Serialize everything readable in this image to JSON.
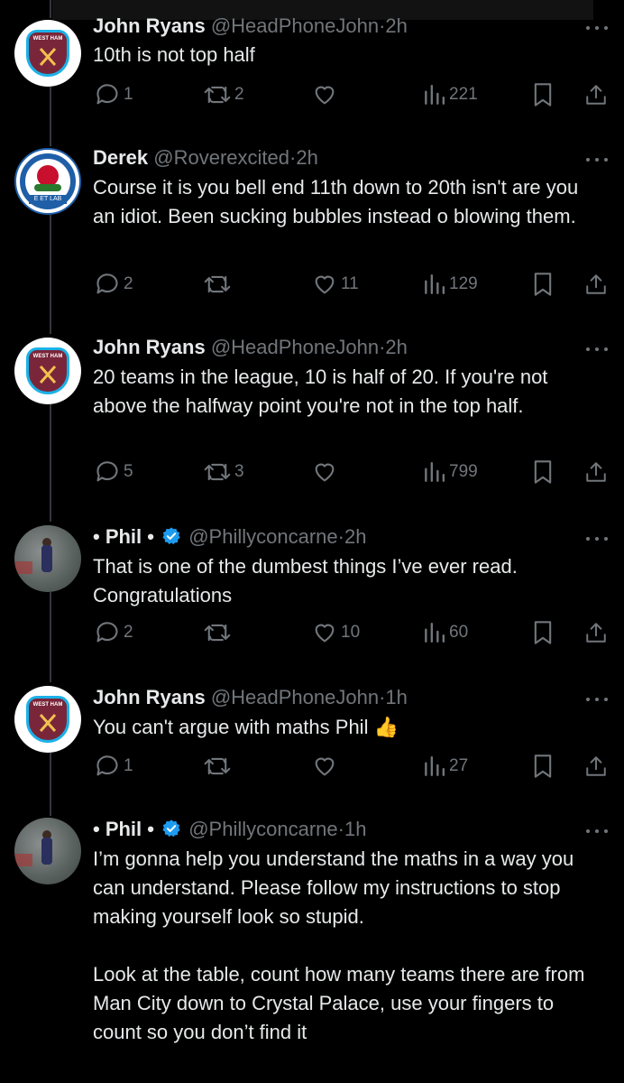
{
  "tweets": [
    {
      "name": "John Ryans",
      "handle": "@HeadPhoneJohn",
      "time": "2h",
      "paragraphs": [
        "10th is not top half"
      ],
      "counts": {
        "reply": "1",
        "retweet": "2",
        "like": "",
        "views": "221"
      },
      "avatar": "west-ham-crest",
      "avatar_text": "WEST HAM"
    },
    {
      "name": "Derek",
      "handle": "@Roverexcited",
      "time": "2h",
      "paragraphs": [
        "Course it is you bell end 11th down to 20th isn't are you an idiot. Been sucking bubbles instead o blowing them."
      ],
      "counts": {
        "reply": "2",
        "retweet": "",
        "like": "11",
        "views": "129"
      },
      "avatar": "blackburn-rovers-crest",
      "avatar_text": "E ET LAB"
    },
    {
      "name": "John Ryans",
      "handle": "@HeadPhoneJohn",
      "time": "2h",
      "paragraphs": [
        "20 teams in the league, 10 is half of 20. If you're not above the halfway point you're not in the top half."
      ],
      "counts": {
        "reply": "5",
        "retweet": "3",
        "like": "",
        "views": "799"
      },
      "avatar": "west-ham-crest",
      "avatar_text": "WEST HAM"
    },
    {
      "name": "• Phil •",
      "handle": "@Phillyconcarne",
      "time": "2h",
      "verified": true,
      "paragraphs": [
        "That is one of the dumbest things I’ve ever read. Congratulations"
      ],
      "counts": {
        "reply": "2",
        "retweet": "",
        "like": "10",
        "views": "60"
      },
      "avatar": "footballer-photo"
    },
    {
      "name": "John Ryans",
      "handle": "@HeadPhoneJohn",
      "time": "1h",
      "paragraphs": [
        "You can't argue with maths Phil"
      ],
      "emoji": "👍",
      "counts": {
        "reply": "1",
        "retweet": "",
        "like": "",
        "views": "27"
      },
      "avatar": "west-ham-crest",
      "avatar_text": "WEST HAM"
    },
    {
      "name": "• Phil •",
      "handle": "@Phillyconcarne",
      "time": "1h",
      "verified": true,
      "paragraphs": [
        "I’m gonna help you understand the maths in a way you can understand. Please follow my instructions to stop making yourself look so stupid.",
        "Look at the table, count how many teams there are from Man City down to Crystal Palace, use your fingers to count so you don’t find it"
      ],
      "counts": {},
      "avatar": "footballer-photo"
    }
  ],
  "separator": "·",
  "colors": {
    "background": "#000000",
    "text": "#e7e9ea",
    "muted": "#71767b",
    "verified": "#1d9bf0",
    "thread_line": "#333639"
  }
}
